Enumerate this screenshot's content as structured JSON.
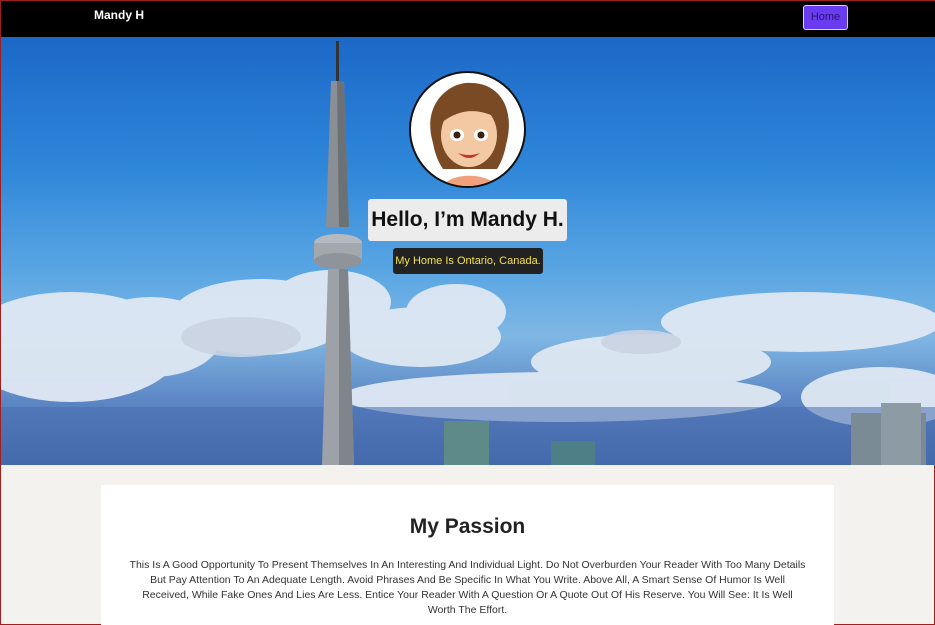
{
  "navbar": {
    "brand": "Mandy H",
    "home_label": "Home"
  },
  "hero": {
    "avatar_alt": "cartoon avatar",
    "title": "Hello, I’m Mandy H.",
    "subtitle": "My Home Is Ontario, Canada."
  },
  "passion": {
    "title": "My Passion",
    "body": "This Is A Good Opportunity To Present Themselves In An Interesting And Individual Light. Do Not Overburden Your Reader With Too Many Details But Pay Attention To An Adequate Length. Avoid Phrases And Be Specific In What You Write. Above All, A Smart Sense Of Humor Is Well Received, While Fake Ones And Lies Are Less. Entice Your Reader With A Question Or A Quote Out Of His Reserve. You Will See: It Is Well Worth The Effort."
  },
  "colors": {
    "navbar_bg": "#000000",
    "home_button": "#6a3cf0",
    "subtitle_text": "#f4e24a",
    "page_bg": "#f4f2ee"
  }
}
